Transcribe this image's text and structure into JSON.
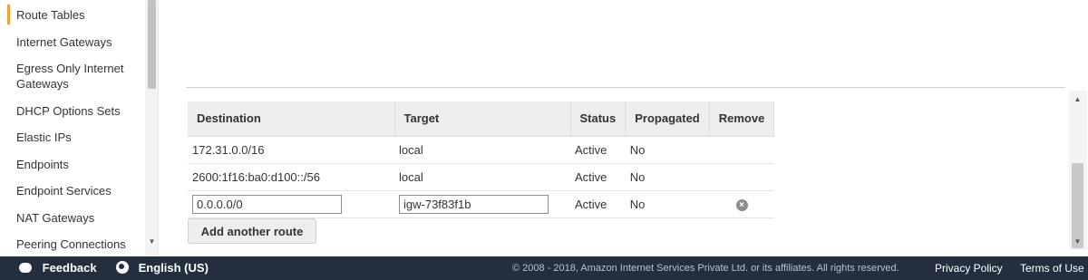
{
  "sidebar": {
    "items": [
      {
        "label": "Route Tables",
        "active": true
      },
      {
        "label": "Internet Gateways"
      },
      {
        "label": "Egress Only Internet Gateways"
      },
      {
        "label": "DHCP Options Sets"
      },
      {
        "label": "Elastic IPs"
      },
      {
        "label": "Endpoints"
      },
      {
        "label": "Endpoint Services"
      },
      {
        "label": "NAT Gateways"
      },
      {
        "label": "Peering Connections"
      }
    ]
  },
  "routes": {
    "headers": {
      "destination": "Destination",
      "target": "Target",
      "status": "Status",
      "propagated": "Propagated",
      "remove": "Remove"
    },
    "rows": [
      {
        "destination": "172.31.0.0/16",
        "target": "local",
        "status": "Active",
        "propagated": "No"
      },
      {
        "destination": "2600:1f16:ba0:d100::/56",
        "target": "local",
        "status": "Active",
        "propagated": "No"
      },
      {
        "destination": "0.0.0.0/0",
        "target": "igw-73f83f1b",
        "status": "Active",
        "propagated": "No",
        "editable": true
      }
    ],
    "add_button_label": "Add another route"
  },
  "footer": {
    "feedback": "Feedback",
    "language": "English (US)",
    "copyright": "© 2008 - 2018, Amazon Internet Services Private Ltd. or its affiliates. All rights reserved.",
    "privacy": "Privacy Policy",
    "terms": "Terms of Use"
  },
  "colors": {
    "footer_bg": "#232f3e",
    "active_accent": "#f0a030",
    "status_active": "#1d8f1d"
  }
}
